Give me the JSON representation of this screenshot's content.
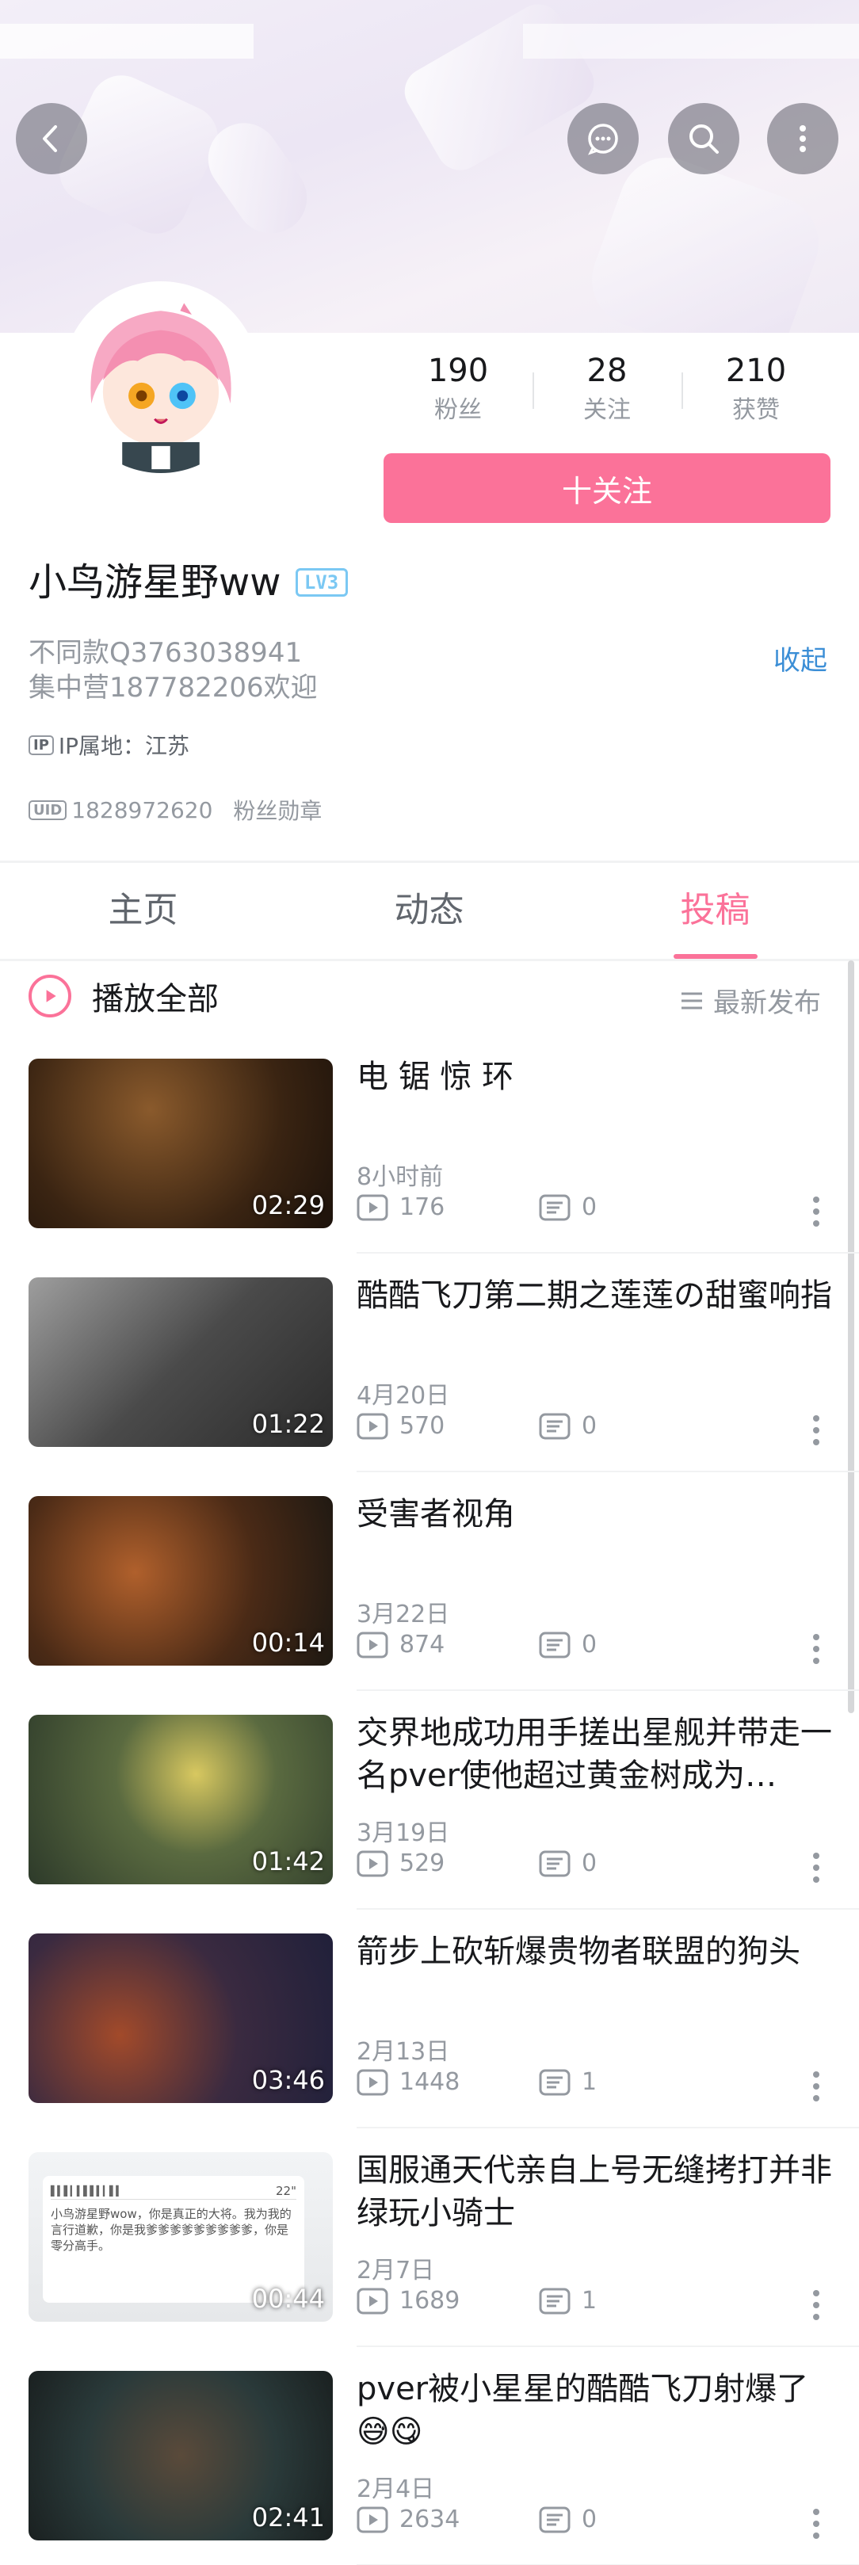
{
  "header": {
    "stats": [
      {
        "value": "190",
        "label": "粉丝"
      },
      {
        "value": "28",
        "label": "关注"
      },
      {
        "value": "210",
        "label": "获赞"
      }
    ],
    "follow_label": "十关注",
    "icons": [
      "back-icon",
      "message-icon",
      "search-icon",
      "more-icon"
    ]
  },
  "profile": {
    "username": "小鸟游星野ww",
    "level": "LV3",
    "bio_line1": "不同款Q3763038941",
    "bio_line2": "集中营187782206欢迎",
    "collapse_label": "收起",
    "ip_tag": "IP",
    "ip_location": "IP属地：江苏",
    "uid_tag": "UID",
    "uid": "1828972620",
    "medal_label": "粉丝勋章"
  },
  "tabs": [
    {
      "label": "主页",
      "active": false
    },
    {
      "label": "动态",
      "active": false
    },
    {
      "label": "投稿",
      "active": true
    }
  ],
  "list_header": {
    "play_all": "播放全部",
    "sort_label": "最新发布"
  },
  "colors": {
    "accent": "#fb7299",
    "link": "#3b8ed6",
    "level": "#7bc8f3"
  },
  "videos": [
    {
      "title": "电 锯 惊 环",
      "duration": "02:29",
      "date": "8小时前",
      "plays": "176",
      "comments": "0"
    },
    {
      "title": "酷酷飞刀第二期之莲莲の甜蜜响指",
      "duration": "01:22",
      "date": "4月20日",
      "plays": "570",
      "comments": "0"
    },
    {
      "title": "受害者视角",
      "duration": "00:14",
      "date": "3月22日",
      "plays": "874",
      "comments": "0"
    },
    {
      "title": "交界地成功用手搓出星舰并带走一名pver使他超过黄金树成为…",
      "duration": "01:42",
      "date": "3月19日",
      "plays": "529",
      "comments": "0"
    },
    {
      "title": "箭步上砍斩爆贵物者联盟的狗头",
      "duration": "03:46",
      "date": "2月13日",
      "plays": "1448",
      "comments": "1"
    },
    {
      "title": "国服通天代亲自上号无缝拷打并非绿玩小骑士",
      "duration": "00:44",
      "date": "2月7日",
      "plays": "1689",
      "comments": "1"
    },
    {
      "title": "pver被小星星的酷酷飞刀射爆了😅😋",
      "duration": "02:41",
      "date": "2月4日",
      "plays": "2634",
      "comments": "0"
    }
  ],
  "thumb_chat": {
    "audio_duration": "22\"",
    "text": "小鸟游星野wow，你是真正的大将。我为我的言行道歉，你是我爹爹爹爹爹爹爹爹爹，你是零分高手。"
  }
}
